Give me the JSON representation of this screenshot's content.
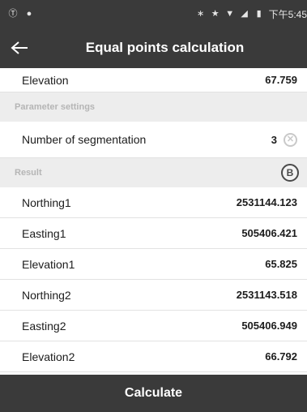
{
  "status_bar": {
    "time": "下午5:45"
  },
  "app_bar": {
    "title": "Equal points calculation"
  },
  "elevation_row": {
    "label": "Elevation",
    "value": "67.759"
  },
  "parameter_section": {
    "title": "Parameter settings"
  },
  "segmentation": {
    "label": "Number of segmentation",
    "value": "3"
  },
  "result_section": {
    "title": "Result",
    "badge": "B"
  },
  "results": [
    {
      "label": "Northing1",
      "value": "2531144.123"
    },
    {
      "label": "Easting1",
      "value": "505406.421"
    },
    {
      "label": "Elevation1",
      "value": "65.825"
    },
    {
      "label": "Northing2",
      "value": "2531143.518"
    },
    {
      "label": "Easting2",
      "value": "505406.949"
    },
    {
      "label": "Elevation2",
      "value": "66.792"
    }
  ],
  "actions": {
    "calculate_label": "Calculate"
  }
}
